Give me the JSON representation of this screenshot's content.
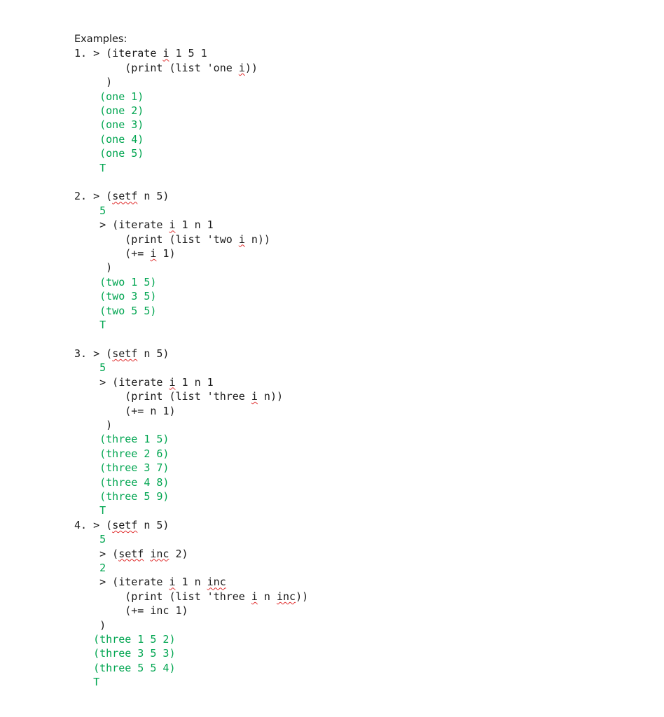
{
  "document": {
    "heading": "Examples:",
    "output_color": "#00a550",
    "text_color": "#1a1a1a",
    "spellcheck_underline_color": "#e03030",
    "blocks": [
      {
        "number": "1.",
        "lines": [
          {
            "kind": "input",
            "prefix": "1. > ",
            "text": "(iterate i 1 5 1",
            "misspelled": [
              "i"
            ]
          },
          {
            "kind": "input",
            "prefix": "        ",
            "text": "(print (list 'one i))",
            "misspelled": [
              "i"
            ]
          },
          {
            "kind": "input",
            "prefix": "     ",
            "text": ")",
            "misspelled": []
          },
          {
            "kind": "output",
            "prefix": "    ",
            "text": "(one 1)",
            "misspelled": []
          },
          {
            "kind": "output",
            "prefix": "    ",
            "text": "(one 2)",
            "misspelled": []
          },
          {
            "kind": "output",
            "prefix": "    ",
            "text": "(one 3)",
            "misspelled": []
          },
          {
            "kind": "output",
            "prefix": "    ",
            "text": "(one 4)",
            "misspelled": []
          },
          {
            "kind": "output",
            "prefix": "    ",
            "text": "(one 5)",
            "misspelled": []
          },
          {
            "kind": "output",
            "prefix": "    ",
            "text": "T",
            "misspelled": []
          },
          {
            "kind": "blank",
            "prefix": "",
            "text": "",
            "misspelled": []
          }
        ]
      },
      {
        "number": "2.",
        "lines": [
          {
            "kind": "input",
            "prefix": "2. > ",
            "text": "(setf n 5)",
            "misspelled": [
              "setf"
            ]
          },
          {
            "kind": "output",
            "prefix": "    ",
            "text": "5",
            "misspelled": []
          },
          {
            "kind": "input",
            "prefix": "    > ",
            "text": "(iterate i 1 n 1",
            "misspelled": [
              "i"
            ]
          },
          {
            "kind": "input",
            "prefix": "        ",
            "text": "(print (list 'two i n))",
            "misspelled": [
              "i"
            ]
          },
          {
            "kind": "input",
            "prefix": "        ",
            "text": "(+= i 1)",
            "misspelled": [
              "i"
            ]
          },
          {
            "kind": "input",
            "prefix": "     ",
            "text": ")",
            "misspelled": []
          },
          {
            "kind": "output",
            "prefix": "    ",
            "text": "(two 1 5)",
            "misspelled": []
          },
          {
            "kind": "output",
            "prefix": "    ",
            "text": "(two 3 5)",
            "misspelled": []
          },
          {
            "kind": "output",
            "prefix": "    ",
            "text": "(two 5 5)",
            "misspelled": []
          },
          {
            "kind": "output",
            "prefix": "    ",
            "text": "T",
            "misspelled": []
          },
          {
            "kind": "blank",
            "prefix": "",
            "text": "",
            "misspelled": []
          }
        ]
      },
      {
        "number": "3.",
        "lines": [
          {
            "kind": "input",
            "prefix": "3. > ",
            "text": "(setf n 5)",
            "misspelled": [
              "setf"
            ]
          },
          {
            "kind": "output",
            "prefix": "    ",
            "text": "5",
            "misspelled": []
          },
          {
            "kind": "input",
            "prefix": "    > ",
            "text": "(iterate i 1 n 1",
            "misspelled": [
              "i"
            ]
          },
          {
            "kind": "input",
            "prefix": "        ",
            "text": "(print (list 'three i n))",
            "misspelled": [
              "i"
            ]
          },
          {
            "kind": "input",
            "prefix": "        ",
            "text": "(+= n 1)",
            "misspelled": []
          },
          {
            "kind": "input",
            "prefix": "     ",
            "text": ")",
            "misspelled": []
          },
          {
            "kind": "output",
            "prefix": "    ",
            "text": "(three 1 5)",
            "misspelled": []
          },
          {
            "kind": "output",
            "prefix": "    ",
            "text": "(three 2 6)",
            "misspelled": []
          },
          {
            "kind": "output",
            "prefix": "    ",
            "text": "(three 3 7)",
            "misspelled": []
          },
          {
            "kind": "output",
            "prefix": "    ",
            "text": "(three 4 8)",
            "misspelled": []
          },
          {
            "kind": "output",
            "prefix": "    ",
            "text": "(three 5 9)",
            "misspelled": []
          },
          {
            "kind": "output",
            "prefix": "    ",
            "text": "T",
            "misspelled": []
          }
        ]
      },
      {
        "number": "4.",
        "lines": [
          {
            "kind": "input",
            "prefix": "4. > ",
            "text": "(setf n 5)",
            "misspelled": [
              "setf"
            ]
          },
          {
            "kind": "output",
            "prefix": "    ",
            "text": "5",
            "misspelled": []
          },
          {
            "kind": "input",
            "prefix": "    > ",
            "text": "(setf inc 2)",
            "misspelled": [
              "setf",
              "inc"
            ]
          },
          {
            "kind": "output",
            "prefix": "    ",
            "text": "2",
            "misspelled": []
          },
          {
            "kind": "input",
            "prefix": "    > ",
            "text": "(iterate i 1 n inc",
            "misspelled": [
              "i",
              "inc"
            ]
          },
          {
            "kind": "input",
            "prefix": "        ",
            "text": "(print (list 'three i n inc))",
            "misspelled": [
              "i",
              "inc"
            ]
          },
          {
            "kind": "input",
            "prefix": "        ",
            "text": "(+= inc 1)",
            "misspelled": []
          },
          {
            "kind": "input",
            "prefix": "    ",
            "text": ")",
            "misspelled": []
          },
          {
            "kind": "output",
            "prefix": "   ",
            "text": "(three 1 5 2)",
            "misspelled": []
          },
          {
            "kind": "output",
            "prefix": "   ",
            "text": "(three 3 5 3)",
            "misspelled": []
          },
          {
            "kind": "output",
            "prefix": "   ",
            "text": "(three 5 5 4)",
            "misspelled": []
          },
          {
            "kind": "output",
            "prefix": "   ",
            "text": "T",
            "misspelled": []
          }
        ]
      }
    ]
  }
}
